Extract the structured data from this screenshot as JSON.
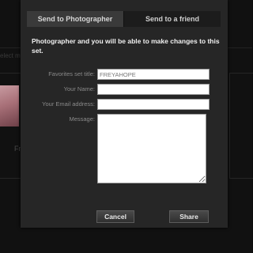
{
  "background": {
    "hint_text": "elect m",
    "caption": "Fr"
  },
  "modal": {
    "tabs": [
      {
        "label": "Send to Photographer",
        "active": true
      },
      {
        "label": "Send to a friend",
        "active": false
      }
    ],
    "intro_text": "Photographer and you will be able to make changes to this set.",
    "fields": {
      "set_title": {
        "label": "Favorites set title:",
        "value": "FREYAHOPE",
        "placeholder": ""
      },
      "your_name": {
        "label": "Your Name:",
        "value": "",
        "placeholder": ""
      },
      "your_email": {
        "label": "Your Email address:",
        "value": "",
        "placeholder": ""
      },
      "message": {
        "label": "Message:",
        "value": ""
      }
    },
    "buttons": {
      "cancel_label": "Cancel",
      "share_label": "Share"
    }
  }
}
